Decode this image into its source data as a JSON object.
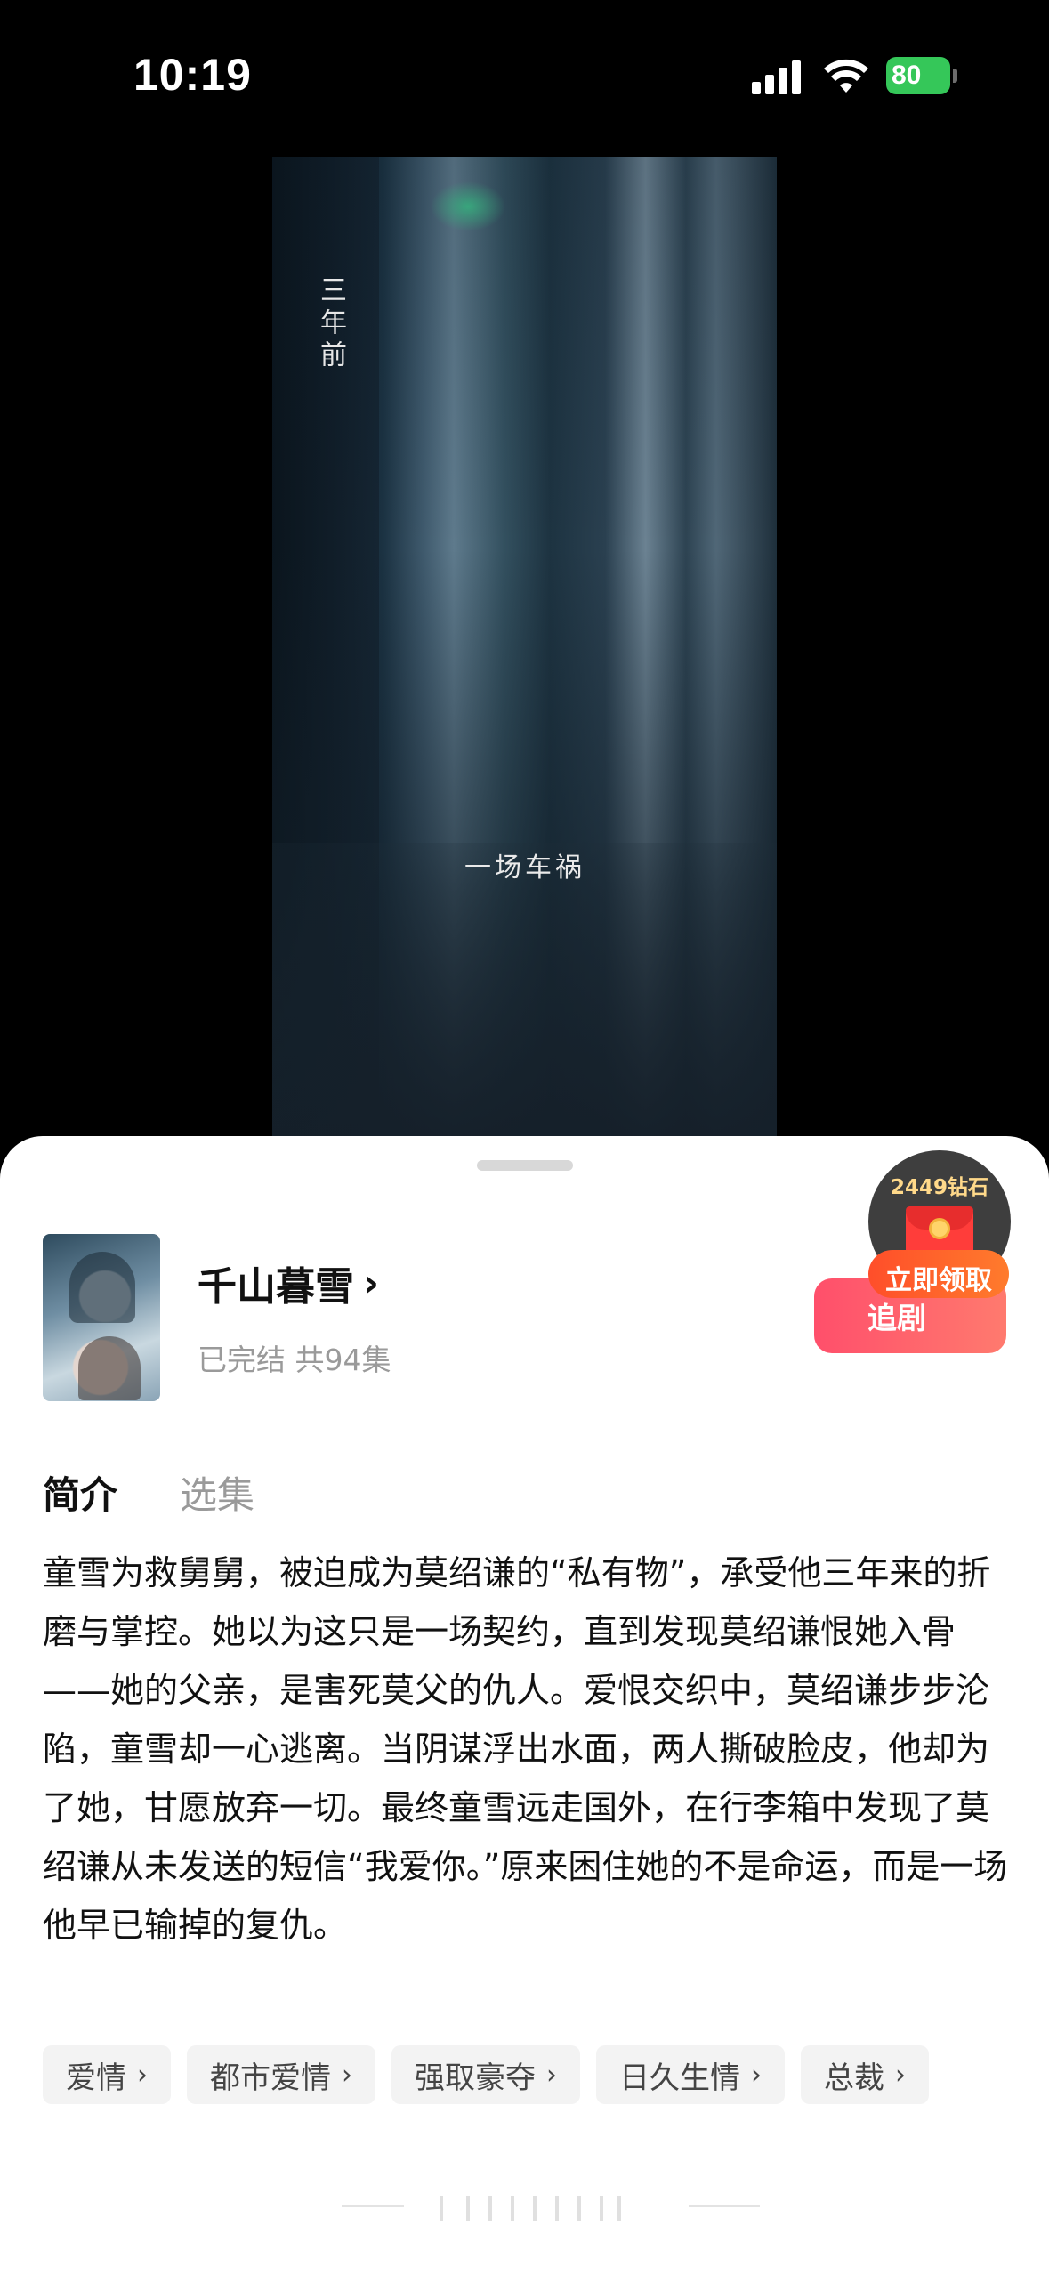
{
  "status_bar": {
    "time": "10:19",
    "battery": "80"
  },
  "video": {
    "caption_top": "三年前",
    "caption_bottom": "一场车祸"
  },
  "drama": {
    "title": "千山暮雪",
    "title_chevron": "›",
    "status": "已完结 共94集",
    "follow_label": "追剧"
  },
  "reward": {
    "diamonds": "2449钻石",
    "claim_label": "立即领取"
  },
  "tabs": [
    {
      "label": "简介",
      "active": true
    },
    {
      "label": "选集",
      "active": false
    }
  ],
  "synopsis": "童雪为救舅舅，被迫成为莫绍谦的“私有物”，承受他三年来的折磨与掌控。她以为这只是一场契约，直到发现莫绍谦恨她入骨——她的父亲，是害死莫父的仇人。爱恨交织中，莫绍谦步步沦陷，童雪却一心逃离。当阴谋浮出水面，两人撕破脸皮，他却为了她，甘愿放弃一切。最终童雪远走国外，在行李箱中发现了莫绍谦从未发送的短信“我爱你。”原来困住她的不是命运，而是一场他早已输掉的复仇。",
  "tags": [
    {
      "label": "爱情"
    },
    {
      "label": "都市爱情"
    },
    {
      "label": "强取豪夺"
    },
    {
      "label": "日久生情"
    },
    {
      "label": "总裁"
    }
  ],
  "tag_chevron": "›",
  "colors": {
    "accent_follow": "#ff5a6c",
    "reward_orange": "#ff5a2b",
    "battery_green": "#35c759"
  }
}
